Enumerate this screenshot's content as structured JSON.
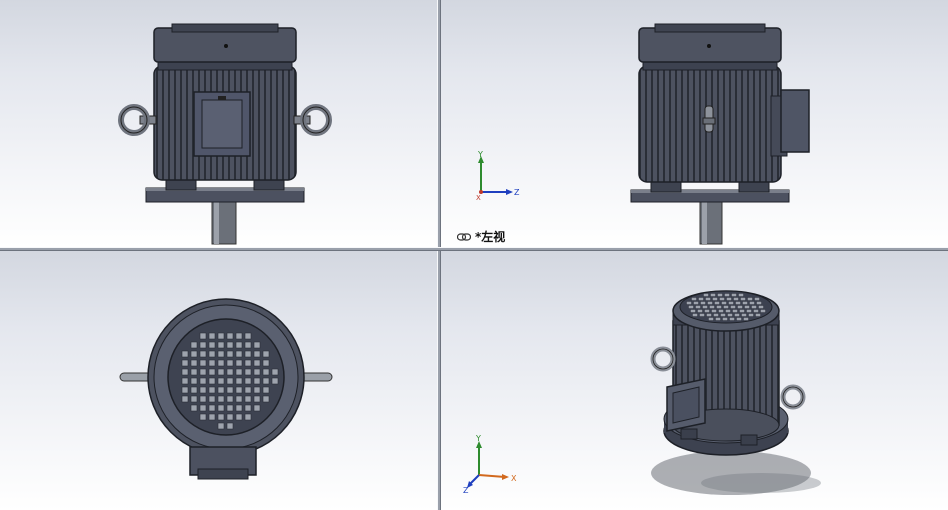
{
  "viewports": {
    "top_left": {
      "name": "front-view"
    },
    "top_right": {
      "name": "left-view",
      "label": "*左视"
    },
    "bottom_left": {
      "name": "top-view"
    },
    "bottom_right": {
      "name": "isometric-view"
    }
  },
  "triad_top_right": {
    "y": "Y",
    "z": "Z",
    "x": "X"
  },
  "triad_bottom_right": {
    "y": "Y",
    "x": "X",
    "z": "Z"
  },
  "colors": {
    "motor_body": "#4a4f5c",
    "motor_dark": "#2b2f38",
    "axis_x": "#c0392b",
    "axis_y": "#2e8b2e",
    "axis_z": "#1f3fbf"
  },
  "icons": {
    "link_views": "link-icon"
  }
}
